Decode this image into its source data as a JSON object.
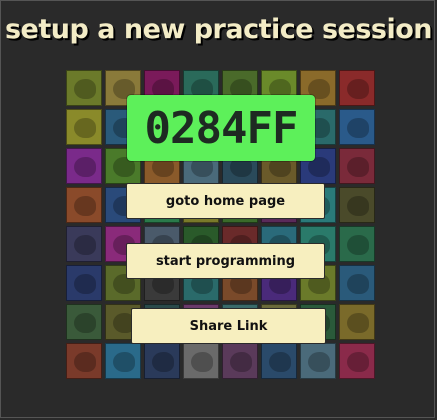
{
  "page": {
    "title": "setup a new practice session"
  },
  "session": {
    "code": "0284FF",
    "code_color": "#5df05a"
  },
  "buttons": {
    "home_label": "goto home page",
    "programming_label": "start programming",
    "share_label": "Share Link"
  },
  "animal_grid": {
    "rows": 8,
    "columns": 8,
    "tiles": [
      {
        "animal": "crocodile",
        "color": "#6b7a2a"
      },
      {
        "animal": "antelope",
        "color": "#8a7a3a"
      },
      {
        "animal": "bat",
        "color": "#7a1a5a"
      },
      {
        "animal": "turtle",
        "color": "#2a6a5a"
      },
      {
        "animal": "frog",
        "color": "#4a6a2a"
      },
      {
        "animal": "butterfly",
        "color": "#6a8a2a"
      },
      {
        "animal": "bison",
        "color": "#8a6a2a"
      },
      {
        "animal": "parrot",
        "color": "#8a2a2a"
      },
      {
        "animal": "cat",
        "color": "#8a8a2a"
      },
      {
        "animal": "lynx",
        "color": "#2a5a7a"
      },
      {
        "animal": "hidden",
        "color": "#5a4a2a"
      },
      {
        "animal": "hidden",
        "color": "#4a5a2a"
      },
      {
        "animal": "hidden",
        "color": "#2a4a6a"
      },
      {
        "animal": "hidden",
        "color": "#5a2a6a"
      },
      {
        "animal": "hidden",
        "color": "#2a6a6a"
      },
      {
        "animal": "fox",
        "color": "#2a5a8a"
      },
      {
        "animal": "tree-frog",
        "color": "#7a2a8a"
      },
      {
        "animal": "toucan",
        "color": "#4a7a2a"
      },
      {
        "animal": "bird",
        "color": "#8a5a2a"
      },
      {
        "animal": "heron",
        "color": "#4a6a7a"
      },
      {
        "animal": "hidden",
        "color": "#2a4a5a"
      },
      {
        "animal": "hidden",
        "color": "#6a5a2a"
      },
      {
        "animal": "butterfly",
        "color": "#2a3a7a"
      },
      {
        "animal": "jellyfish",
        "color": "#7a2a3a"
      },
      {
        "animal": "kangaroo",
        "color": "#8a4a2a"
      },
      {
        "animal": "kingfisher",
        "color": "#2a4a7a"
      },
      {
        "animal": "hidden",
        "color": "#2a7a4a"
      },
      {
        "animal": "hidden",
        "color": "#7a7a2a"
      },
      {
        "animal": "hidden",
        "color": "#3a6a2a"
      },
      {
        "animal": "hidden",
        "color": "#5a2a5a"
      },
      {
        "animal": "hidden",
        "color": "#2a7a7a"
      },
      {
        "animal": "moose",
        "color": "#4a4a2a"
      },
      {
        "animal": "mouse",
        "color": "#3a3a5a"
      },
      {
        "animal": "lemur",
        "color": "#8a2a7a"
      },
      {
        "animal": "owl",
        "color": "#4a5a6a"
      },
      {
        "animal": "panda",
        "color": "#2a5a2a"
      },
      {
        "animal": "bird",
        "color": "#6a2a2a"
      },
      {
        "animal": "hidden",
        "color": "#2a6a7a"
      },
      {
        "animal": "hidden",
        "color": "#2a7a6a"
      },
      {
        "animal": "chameleon",
        "color": "#2a6a4a"
      },
      {
        "animal": "puffin",
        "color": "#2a3a6a"
      },
      {
        "animal": "rabbit",
        "color": "#5a6a2a"
      },
      {
        "animal": "raccoon",
        "color": "#3a3a3a"
      },
      {
        "animal": "ray",
        "color": "#2a6a6a"
      },
      {
        "animal": "hidden",
        "color": "#7a4a2a"
      },
      {
        "animal": "hidden",
        "color": "#4a2a7a"
      },
      {
        "animal": "seal",
        "color": "#6a7a2a"
      },
      {
        "animal": "shark",
        "color": "#2a5a7a"
      },
      {
        "animal": "skunk",
        "color": "#3a5a3a"
      },
      {
        "animal": "snake",
        "color": "#5a5a2a"
      },
      {
        "animal": "hidden",
        "color": "#2a4a4a"
      },
      {
        "animal": "hidden",
        "color": "#6a3a6a"
      },
      {
        "animal": "hidden",
        "color": "#3a6a6a"
      },
      {
        "animal": "hidden",
        "color": "#6a6a3a"
      },
      {
        "animal": "hidden",
        "color": "#2a5a3a"
      },
      {
        "animal": "tiger",
        "color": "#7a6a2a"
      },
      {
        "animal": "toucan",
        "color": "#7a3a2a"
      },
      {
        "animal": "fish",
        "color": "#2a6a8a"
      },
      {
        "animal": "turtle",
        "color": "#2a3a5a"
      },
      {
        "animal": "vulture",
        "color": "#6a6a6a"
      },
      {
        "animal": "wallaby",
        "color": "#5a3a5a"
      },
      {
        "animal": "whale",
        "color": "#2a4a6a"
      },
      {
        "animal": "wolf",
        "color": "#4a6a7a"
      },
      {
        "animal": "zebra",
        "color": "#8a2a4a"
      }
    ]
  }
}
